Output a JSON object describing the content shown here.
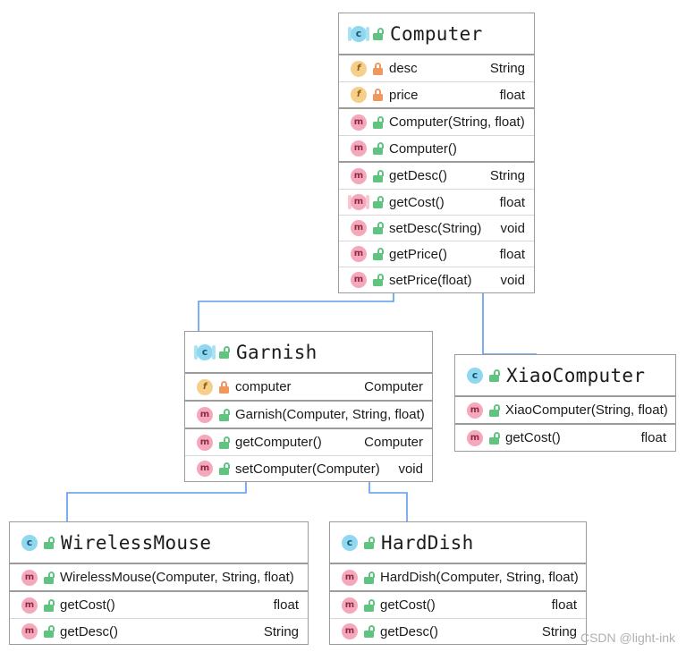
{
  "diagram": {
    "title": "Computer decorator UML class diagram",
    "watermark": "CSDN @light-ink",
    "colors": {
      "connector": "#5b9bf0",
      "box_border": "#9b9b9b",
      "class_badge": "#8fd8ef",
      "field_badge": "#f6d08a",
      "method_badge": "#f5a8bb",
      "lock_private": "#f0975e",
      "lock_public": "#5fc47f",
      "background": "#ffffff"
    }
  },
  "classes": {
    "computer": {
      "name": "Computer",
      "abstract": true,
      "visibility": "public",
      "fields": [
        {
          "icon": "field-icon",
          "lock": "private",
          "name": "desc",
          "type": "String"
        },
        {
          "icon": "field-icon",
          "lock": "private",
          "name": "price",
          "type": "float"
        }
      ],
      "constructors": [
        {
          "icon": "method-icon",
          "lock": "public",
          "abstract": false,
          "name": "Computer(String, float)",
          "type": ""
        },
        {
          "icon": "method-icon",
          "lock": "public",
          "abstract": false,
          "name": "Computer()",
          "type": ""
        }
      ],
      "methods": [
        {
          "icon": "method-icon",
          "lock": "public",
          "abstract": false,
          "name": "getDesc()",
          "type": "String"
        },
        {
          "icon": "method-icon",
          "lock": "public",
          "abstract": true,
          "name": "getCost()",
          "type": "float"
        },
        {
          "icon": "method-icon",
          "lock": "public",
          "abstract": false,
          "name": "setDesc(String)",
          "type": "void"
        },
        {
          "icon": "method-icon",
          "lock": "public",
          "abstract": false,
          "name": "getPrice()",
          "type": "float"
        },
        {
          "icon": "method-icon",
          "lock": "public",
          "abstract": false,
          "name": "setPrice(float)",
          "type": "void"
        }
      ]
    },
    "garnish": {
      "name": "Garnish",
      "abstract": true,
      "visibility": "public",
      "fields": [
        {
          "icon": "field-icon",
          "lock": "private",
          "name": "computer",
          "type": "Computer"
        }
      ],
      "constructors": [
        {
          "icon": "method-icon",
          "lock": "public",
          "abstract": false,
          "name": "Garnish(Computer, String, float)",
          "type": ""
        }
      ],
      "methods": [
        {
          "icon": "method-icon",
          "lock": "public",
          "abstract": false,
          "name": "getComputer()",
          "type": "Computer"
        },
        {
          "icon": "method-icon",
          "lock": "public",
          "abstract": false,
          "name": "setComputer(Computer)",
          "type": "void"
        }
      ]
    },
    "xiaocomputer": {
      "name": "XiaoComputer",
      "abstract": false,
      "visibility": "public",
      "fields": [],
      "constructors": [
        {
          "icon": "method-icon",
          "lock": "public",
          "abstract": false,
          "name": "XiaoComputer(String, float)",
          "type": ""
        }
      ],
      "methods": [
        {
          "icon": "method-icon",
          "lock": "public",
          "abstract": false,
          "name": "getCost()",
          "type": "float"
        }
      ]
    },
    "wirelessmouse": {
      "name": "WirelessMouse",
      "abstract": false,
      "visibility": "public",
      "fields": [],
      "constructors": [
        {
          "icon": "method-icon",
          "lock": "public",
          "abstract": false,
          "name": "WirelessMouse(Computer, String, float)",
          "type": ""
        }
      ],
      "methods": [
        {
          "icon": "method-icon",
          "lock": "public",
          "abstract": false,
          "name": "getCost()",
          "type": "float"
        },
        {
          "icon": "method-icon",
          "lock": "public",
          "abstract": false,
          "name": "getDesc()",
          "type": "String"
        }
      ]
    },
    "harddish": {
      "name": "HardDish",
      "abstract": false,
      "visibility": "public",
      "fields": [],
      "constructors": [
        {
          "icon": "method-icon",
          "lock": "public",
          "abstract": false,
          "name": "HardDish(Computer, String, float)",
          "type": ""
        }
      ],
      "methods": [
        {
          "icon": "method-icon",
          "lock": "public",
          "abstract": false,
          "name": "getCost()",
          "type": "float"
        },
        {
          "icon": "method-icon",
          "lock": "public",
          "abstract": false,
          "name": "getDesc()",
          "type": "String"
        }
      ]
    }
  },
  "relations": [
    {
      "type": "generalization",
      "from": "Garnish",
      "to": "Computer"
    },
    {
      "type": "generalization",
      "from": "XiaoComputer",
      "to": "Computer"
    },
    {
      "type": "generalization",
      "from": "WirelessMouse",
      "to": "Garnish"
    },
    {
      "type": "generalization",
      "from": "HardDish",
      "to": "Garnish"
    }
  ]
}
